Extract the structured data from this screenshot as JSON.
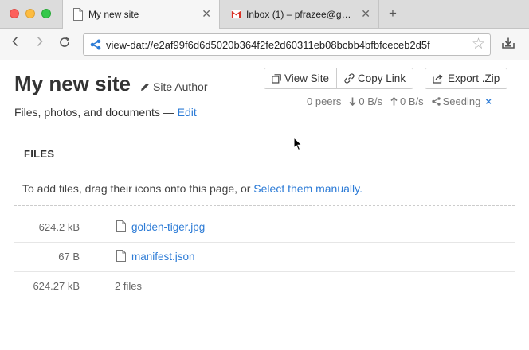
{
  "browser": {
    "tabs": [
      {
        "title": "My new site",
        "icon": "page-icon",
        "active": true
      },
      {
        "title": "Inbox (1) – pfrazee@g…",
        "icon": "gmail-icon",
        "active": false
      }
    ],
    "new_tab_label": "+",
    "url": "view-dat://e2af99f6d6d5020b364f2fe2d60311eb08bcbb4bfbfceceb2d5f"
  },
  "site": {
    "title": "My new site",
    "author": "Site Author",
    "description": "Files, photos, and documents —",
    "edit_label": "Edit"
  },
  "actions": {
    "view_site": "View Site",
    "copy_link": "Copy Link",
    "export_zip": "Export .Zip"
  },
  "stats": {
    "peers": "0 peers",
    "download": "0 B/s",
    "upload": "0 B/s",
    "status": "Seeding",
    "close": "×"
  },
  "files": {
    "header": "FILES",
    "drop_text": "To add files, drag their icons onto this page, or",
    "select_link": "Select them manually.",
    "rows": [
      {
        "size": "624.2 kB",
        "name": "golden-tiger.jpg"
      },
      {
        "size": "67 B",
        "name": "manifest.json"
      }
    ],
    "total_size": "624.27 kB",
    "total_count": "2 files"
  },
  "colors": {
    "link": "#2c7bd6",
    "tabbar": "#dcdcdc",
    "gmail": "#d93025"
  }
}
